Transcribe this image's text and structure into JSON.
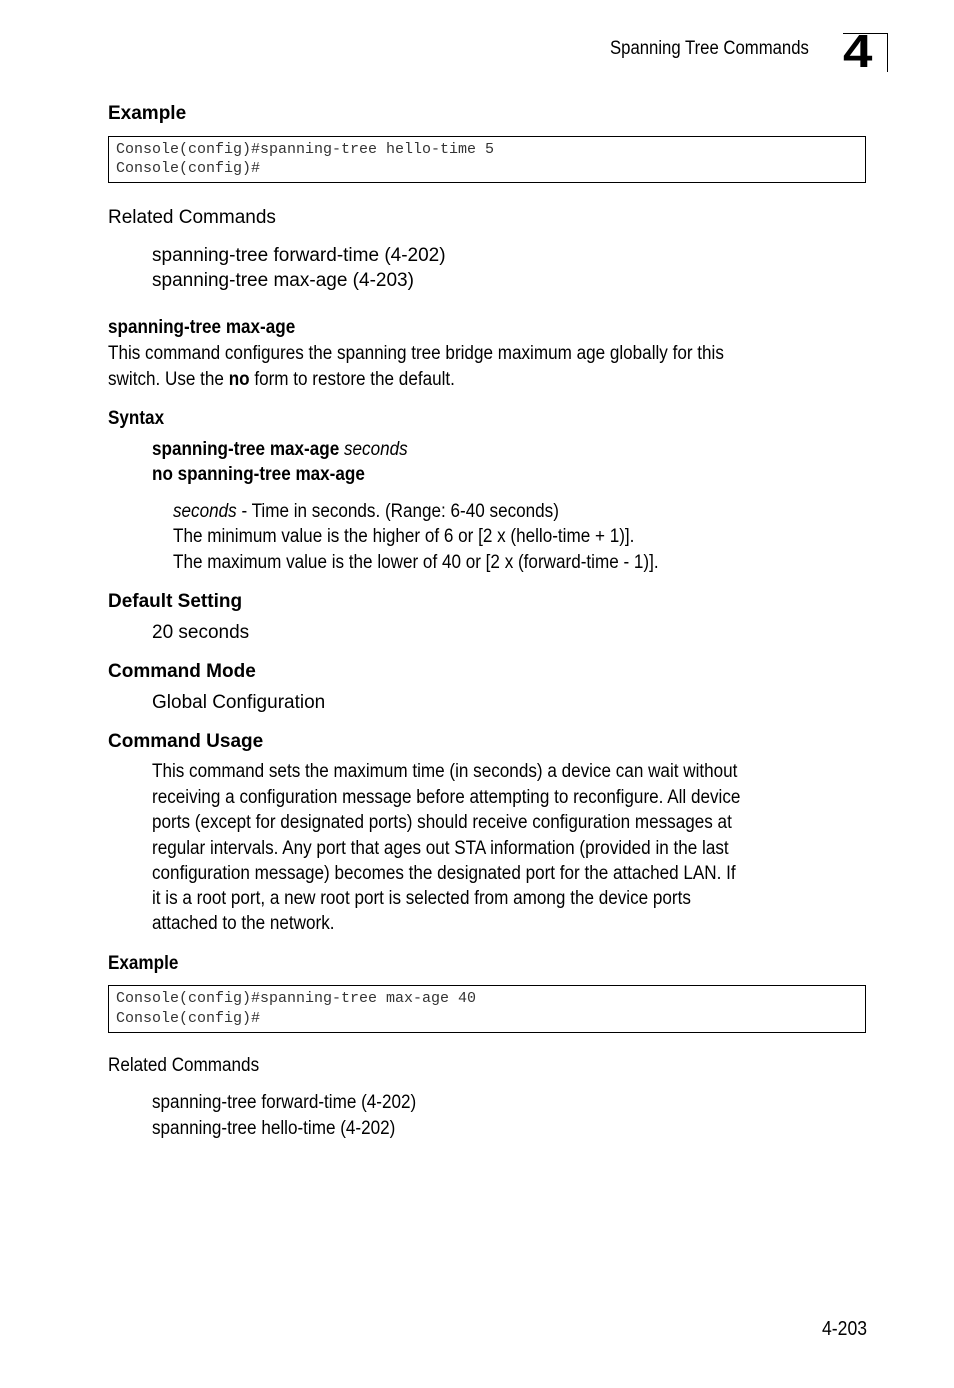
{
  "header": {
    "section_title": "Spanning Tree Commands",
    "chapter_number": "4"
  },
  "top_example": {
    "heading": "Example",
    "code_lines": [
      "Console(config)#spanning-tree hello-time 5",
      "Console(config)#"
    ]
  },
  "top_related": {
    "heading": "Related Commands",
    "items": [
      "spanning-tree forward-time (4-202)",
      "spanning-tree max-age (4-203)"
    ]
  },
  "command": {
    "title": "spanning-tree max-age",
    "description_line1": "This command configures the spanning tree bridge maximum age globally for this",
    "description_line2_pre": "switch. Use the ",
    "description_line2_bold": "no",
    "description_line2_post": " form to restore the default."
  },
  "syntax": {
    "heading": "Syntax",
    "line1_bold": "spanning-tree max-age",
    "line1_italic": "seconds",
    "line2_bold": "no spanning-tree max-age",
    "param_name": "seconds",
    "param_desc": " - Time in seconds. (Range: 6-40 seconds)",
    "param_line2": "The minimum value is the higher of 6 or [2 x (hello-time + 1)].",
    "param_line3": "The maximum value is the lower of 40 or [2 x (forward-time - 1)]."
  },
  "default_setting": {
    "heading": "Default Setting",
    "value": "20 seconds"
  },
  "command_mode": {
    "heading": "Command Mode",
    "value": "Global Configuration"
  },
  "command_usage": {
    "heading": "Command Usage",
    "lines": [
      "This command sets the maximum time (in seconds) a device can wait without",
      "receiving a configuration message before attempting to reconfigure. All device",
      "ports (except for designated ports) should receive configuration messages at",
      "regular intervals. Any port that ages out STA information (provided in the last",
      "configuration message) becomes the designated port for the attached LAN. If",
      "it is a root port, a new root port is selected from among the device ports",
      "attached to the network."
    ]
  },
  "bottom_example": {
    "heading": "Example",
    "code_lines": [
      "Console(config)#spanning-tree max-age 40",
      "Console(config)#"
    ]
  },
  "bottom_related": {
    "heading": "Related Commands",
    "items": [
      "spanning-tree forward-time (4-202)",
      "spanning-tree hello-time (4-202)"
    ]
  },
  "footer": {
    "page_number": "4-203"
  }
}
